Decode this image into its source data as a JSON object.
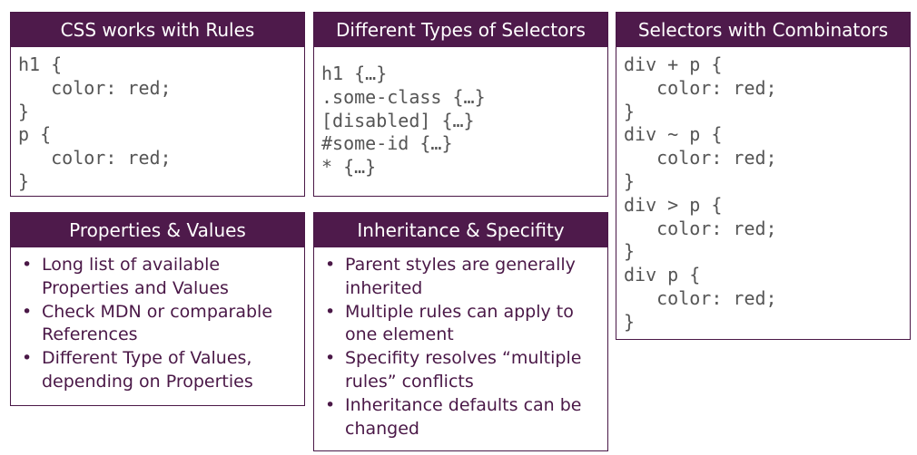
{
  "colors": {
    "header_bg": "#4e1a4b",
    "border": "#4a1847",
    "code_text": "#555555",
    "bullet_text": "#4a1847"
  },
  "cards": {
    "css_rules": {
      "title": "CSS works with Rules",
      "lines": [
        "h1 {",
        "   color: red;",
        "}",
        "p {",
        "   color: red;",
        "}"
      ]
    },
    "selectors": {
      "title": "Different Types of Selectors",
      "lines": [
        "h1 {…}",
        ".some-class {…}",
        "[disabled] {…}",
        "#some-id {…}",
        "* {…}"
      ]
    },
    "combinators": {
      "title": "Selectors with Combinators",
      "lines": [
        "div + p {",
        "   color: red;",
        "}",
        "div ~ p {",
        "   color: red;",
        "}",
        "div > p {",
        "   color: red;",
        "}",
        "div p {",
        "   color: red;",
        "}"
      ]
    },
    "properties": {
      "title": "Properties & Values",
      "items": [
        "Long list of available Properties and Values",
        "Check MDN or comparable References",
        "Different Type of Values, depending on Properties"
      ]
    },
    "inheritance": {
      "title": "Inheritance & Specifity",
      "items": [
        "Parent styles are generally inherited",
        "Multiple rules can apply to one element",
        "Specifity resolves “multiple rules” conflicts",
        "Inheritance defaults can be changed"
      ]
    }
  }
}
